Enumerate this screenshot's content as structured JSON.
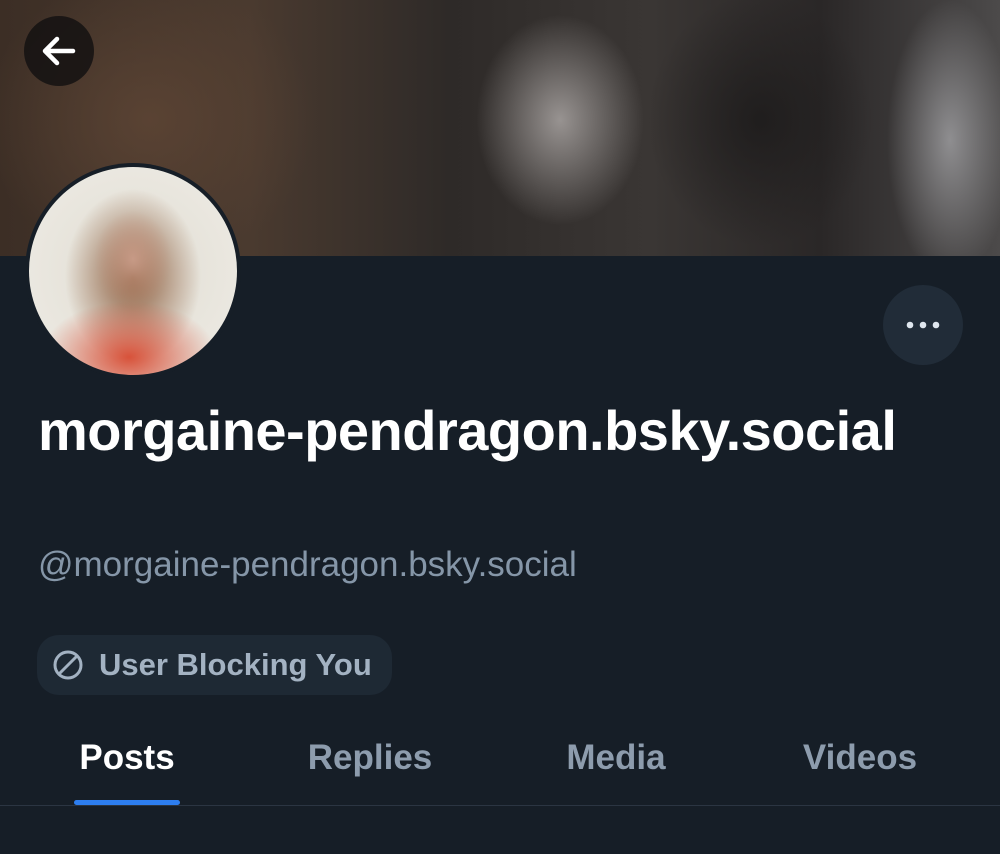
{
  "header": {
    "back_icon": "arrow-left-icon",
    "more_icon": "ellipsis-icon"
  },
  "profile": {
    "display_name": "morgaine-pendragon.bsky.social",
    "handle": "@morgaine-pendragon.bsky.social"
  },
  "status_badge": {
    "icon": "block-icon",
    "label": "User Blocking You"
  },
  "tabs": [
    {
      "label": "Posts",
      "active": true
    },
    {
      "label": "Replies",
      "active": false
    },
    {
      "label": "Media",
      "active": false
    },
    {
      "label": "Videos",
      "active": false
    }
  ],
  "colors": {
    "background": "#161e27",
    "accent": "#2d7ef0",
    "muted_text": "#8596a8",
    "badge_bg": "#1e2934"
  }
}
